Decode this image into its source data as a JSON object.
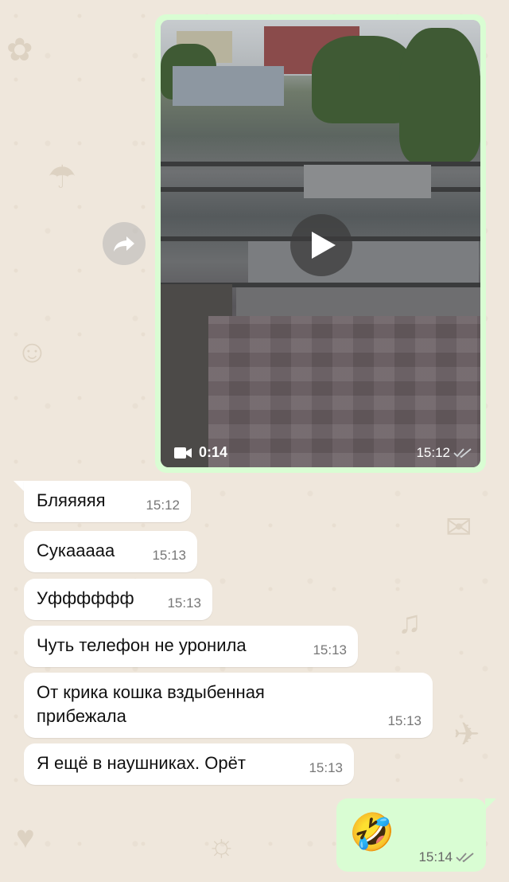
{
  "video_message": {
    "duration": "0:14",
    "time": "15:12",
    "status_icon": "double-check-icon",
    "play_icon": "play-icon",
    "camera_icon": "video-camera-icon"
  },
  "forward_icon": "forward-icon",
  "incoming_messages": [
    {
      "text": "Бляяяяя",
      "time": "15:12"
    },
    {
      "text": "Сукааааа",
      "time": "15:13"
    },
    {
      "text": "Уфффффф",
      "time": "15:13"
    },
    {
      "text": "Чуть телефон не уронила",
      "time": "15:13"
    },
    {
      "text": "От крика кошка вздыбенная прибежала",
      "time": "15:13"
    },
    {
      "text": "Я ещё в наушниках. Орёт",
      "time": "15:13"
    }
  ],
  "outgoing_emoji": {
    "emoji": "🤣",
    "time": "15:14",
    "status_icon": "double-check-icon"
  },
  "colors": {
    "background": "#efe7dc",
    "outgoing_bubble": "#d9fdd3",
    "incoming_bubble": "#ffffff",
    "read_check": "#8a8a8a"
  }
}
